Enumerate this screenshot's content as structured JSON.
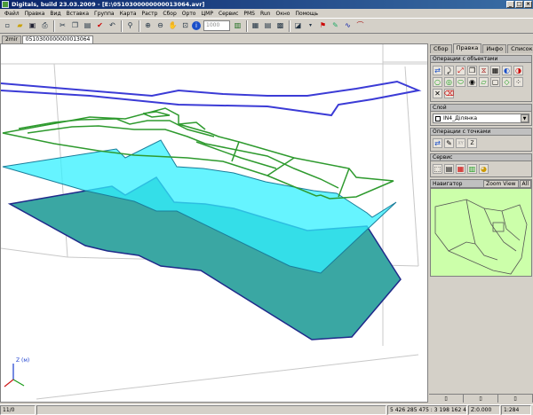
{
  "window": {
    "title": "Digitals, build 23.03.2009 - [E:\\0510300000000013064.avr]",
    "buttons": {
      "minimize": "_",
      "maximize": "□",
      "close": "×"
    }
  },
  "menu": [
    "Файл",
    "Правка",
    "Вид",
    "Вставка",
    "Группа",
    "Карта",
    "Растр",
    "Сбор",
    "Орто",
    "ЦМР",
    "Сервис",
    "PMS",
    "Run",
    "Окно",
    "Помощь"
  ],
  "toolbar": {
    "zoom_value": "1000"
  },
  "doc_tabs": [
    {
      "label": "2mir"
    },
    {
      "label": "0510300000000013064"
    }
  ],
  "viewport": {
    "axis_label": "Z (м)",
    "colors": {
      "blue_outline": "#3b3bd6",
      "green_outline": "#2e9a2e",
      "cyan_plane": "#33f0ff",
      "teal_plane": "#3aa7a3"
    }
  },
  "right_panel": {
    "tabs": [
      "Сбор",
      "Правка",
      "Инфо",
      "Список"
    ],
    "active_tab": "Правка",
    "groups": {
      "object_ops": "Операции с объектами",
      "layer": "Слой",
      "point_ops": "Операции с точками",
      "service": "Сервис"
    },
    "layer_value": "IN4_Ділянка",
    "point_xy": "XY",
    "point_z": "Z",
    "navigator": {
      "title": "Навигатор",
      "zoom_view": "Zoom View",
      "all": "All",
      "map_color": "#ccffaa"
    }
  },
  "status": {
    "left": "11/0",
    "coords": "5 426 285 475 : 3 198 162 484",
    "z": "Z:0.000",
    "scale": "1:284"
  }
}
